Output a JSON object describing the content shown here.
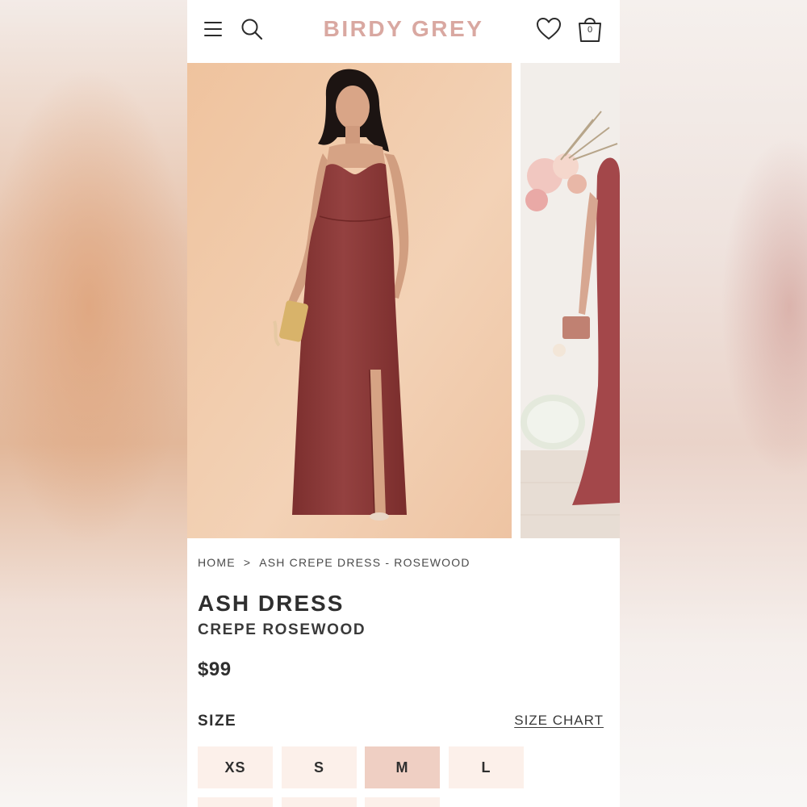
{
  "header": {
    "logo": "BIRDY GREY",
    "cart_count": "0",
    "logo_color": "#d9a8a1"
  },
  "icons": {
    "menu": "hamburger-menu-icon",
    "search": "search-icon",
    "wishlist": "heart-icon",
    "cart": "shopping-bag-icon"
  },
  "gallery": {
    "images": [
      "product-photo-front",
      "product-photo-styled"
    ],
    "dress_color": "#8e3a38",
    "backdrop_color": "#f0c9a7"
  },
  "breadcrumb": {
    "items": [
      "HOME",
      "ASH CREPE DRESS - ROSEWOOD"
    ],
    "separator": ">"
  },
  "product": {
    "title": "ASH DRESS",
    "subtitle": "CREPE ROSEWOOD",
    "price": "$99"
  },
  "size_section": {
    "label": "SIZE",
    "chart_link": "SIZE CHART",
    "options": [
      "XS",
      "S",
      "M",
      "L"
    ],
    "selected": "M",
    "selected_color": "#efcfc3",
    "option_color": "#fcf0ea"
  }
}
